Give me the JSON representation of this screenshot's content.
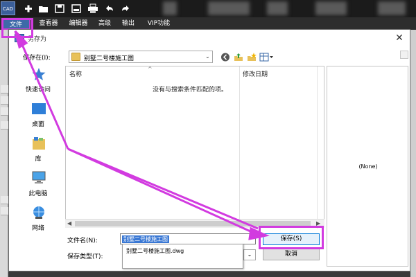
{
  "app": {
    "logo_text": "CAD",
    "toolbar_icons": [
      "new-icon",
      "open-folder-icon",
      "save-icon",
      "save-as-icon",
      "print-icon",
      "undo-icon",
      "redo-icon"
    ],
    "menu": [
      "文件",
      "查看器",
      "编辑器",
      "高级",
      "输出",
      "VIP功能"
    ]
  },
  "dialog": {
    "title": "另存为",
    "close_glyph": "✕",
    "save_in_label": "保存在(I):",
    "location": "别墅二号楼施工图",
    "places": [
      "快速访问",
      "桌面",
      "库",
      "此电脑",
      "网络"
    ],
    "columns": [
      "名称",
      "修改日期"
    ],
    "empty_message": "没有与搜索条件匹配的项。",
    "preview_text": "(None)",
    "file_name_label": "文件名(N):",
    "file_name_value": "别墅二号楼施工图",
    "file_type_label": "保存类型(T):",
    "suggestion": "别墅二号楼施工图.dwg",
    "save_button": "保存(S)",
    "cancel_button": "取消"
  },
  "colors": {
    "annotation": "#d23be0",
    "selection": "#3a78d4",
    "menu_active": "#3d6aa8"
  }
}
